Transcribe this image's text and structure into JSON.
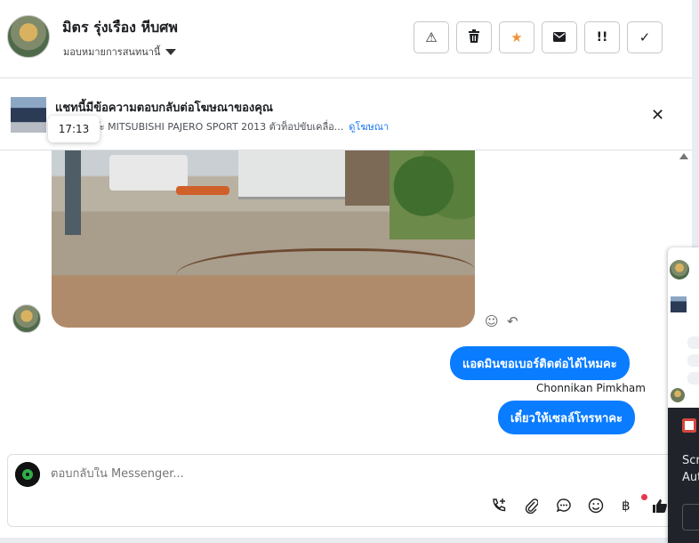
{
  "header": {
    "contact_name": "มิตร รุ่งเรือง หีบศพ",
    "assign_label": "มอบหมายการสนทนานี้",
    "actions": [
      {
        "name": "spam-button",
        "icon": "⚠",
        "color": "#1c1e21"
      },
      {
        "name": "delete-button",
        "icon": "🗑",
        "color": "#1c1e21"
      },
      {
        "name": "star-button",
        "icon": "★",
        "color": "#f0923a"
      },
      {
        "name": "mark-unread-button",
        "icon": "✉",
        "color": "#1c1e21"
      },
      {
        "name": "follow-up-button",
        "icon": "!!",
        "color": "#1c1e21"
      },
      {
        "name": "done-button",
        "icon": "✓",
        "color": "#1c1e21"
      }
    ]
  },
  "ad_banner": {
    "title": "แชทนี้มีข้อความตอบกลับต่อโฆษณาของคุณ",
    "description": "4WD นะจ๊ะ MITSUBISHI PAJERO SPORT 2013 ตัวท็อปขับเคลื่อ...",
    "link_label": "ดูโฆษณา",
    "tooltip_time": "17:13",
    "close_icon": "✕"
  },
  "messages": [
    {
      "type": "image",
      "from": "contact"
    },
    {
      "type": "text",
      "from": "page",
      "text": "แอดมินขอเบอร์ติดต่อได้ไหมคะ"
    },
    {
      "type": "sender",
      "text": "Chonnikan Pimkham"
    },
    {
      "type": "text",
      "from": "page",
      "text": "เดี๋ยวให้เซลล์โทรหาคะ"
    }
  ],
  "composer": {
    "placeholder": "ตอบกลับใน Messenger...",
    "icons": [
      "call-add-icon",
      "attachment-icon",
      "saved-reply-icon",
      "emoji-icon",
      "payment-icon",
      "like-icon"
    ]
  },
  "side_overlay": {
    "line1": "Scr",
    "line2": "Aut"
  },
  "colors": {
    "accent": "#0a7cff",
    "link": "#1877f2",
    "star": "#f0923a"
  }
}
